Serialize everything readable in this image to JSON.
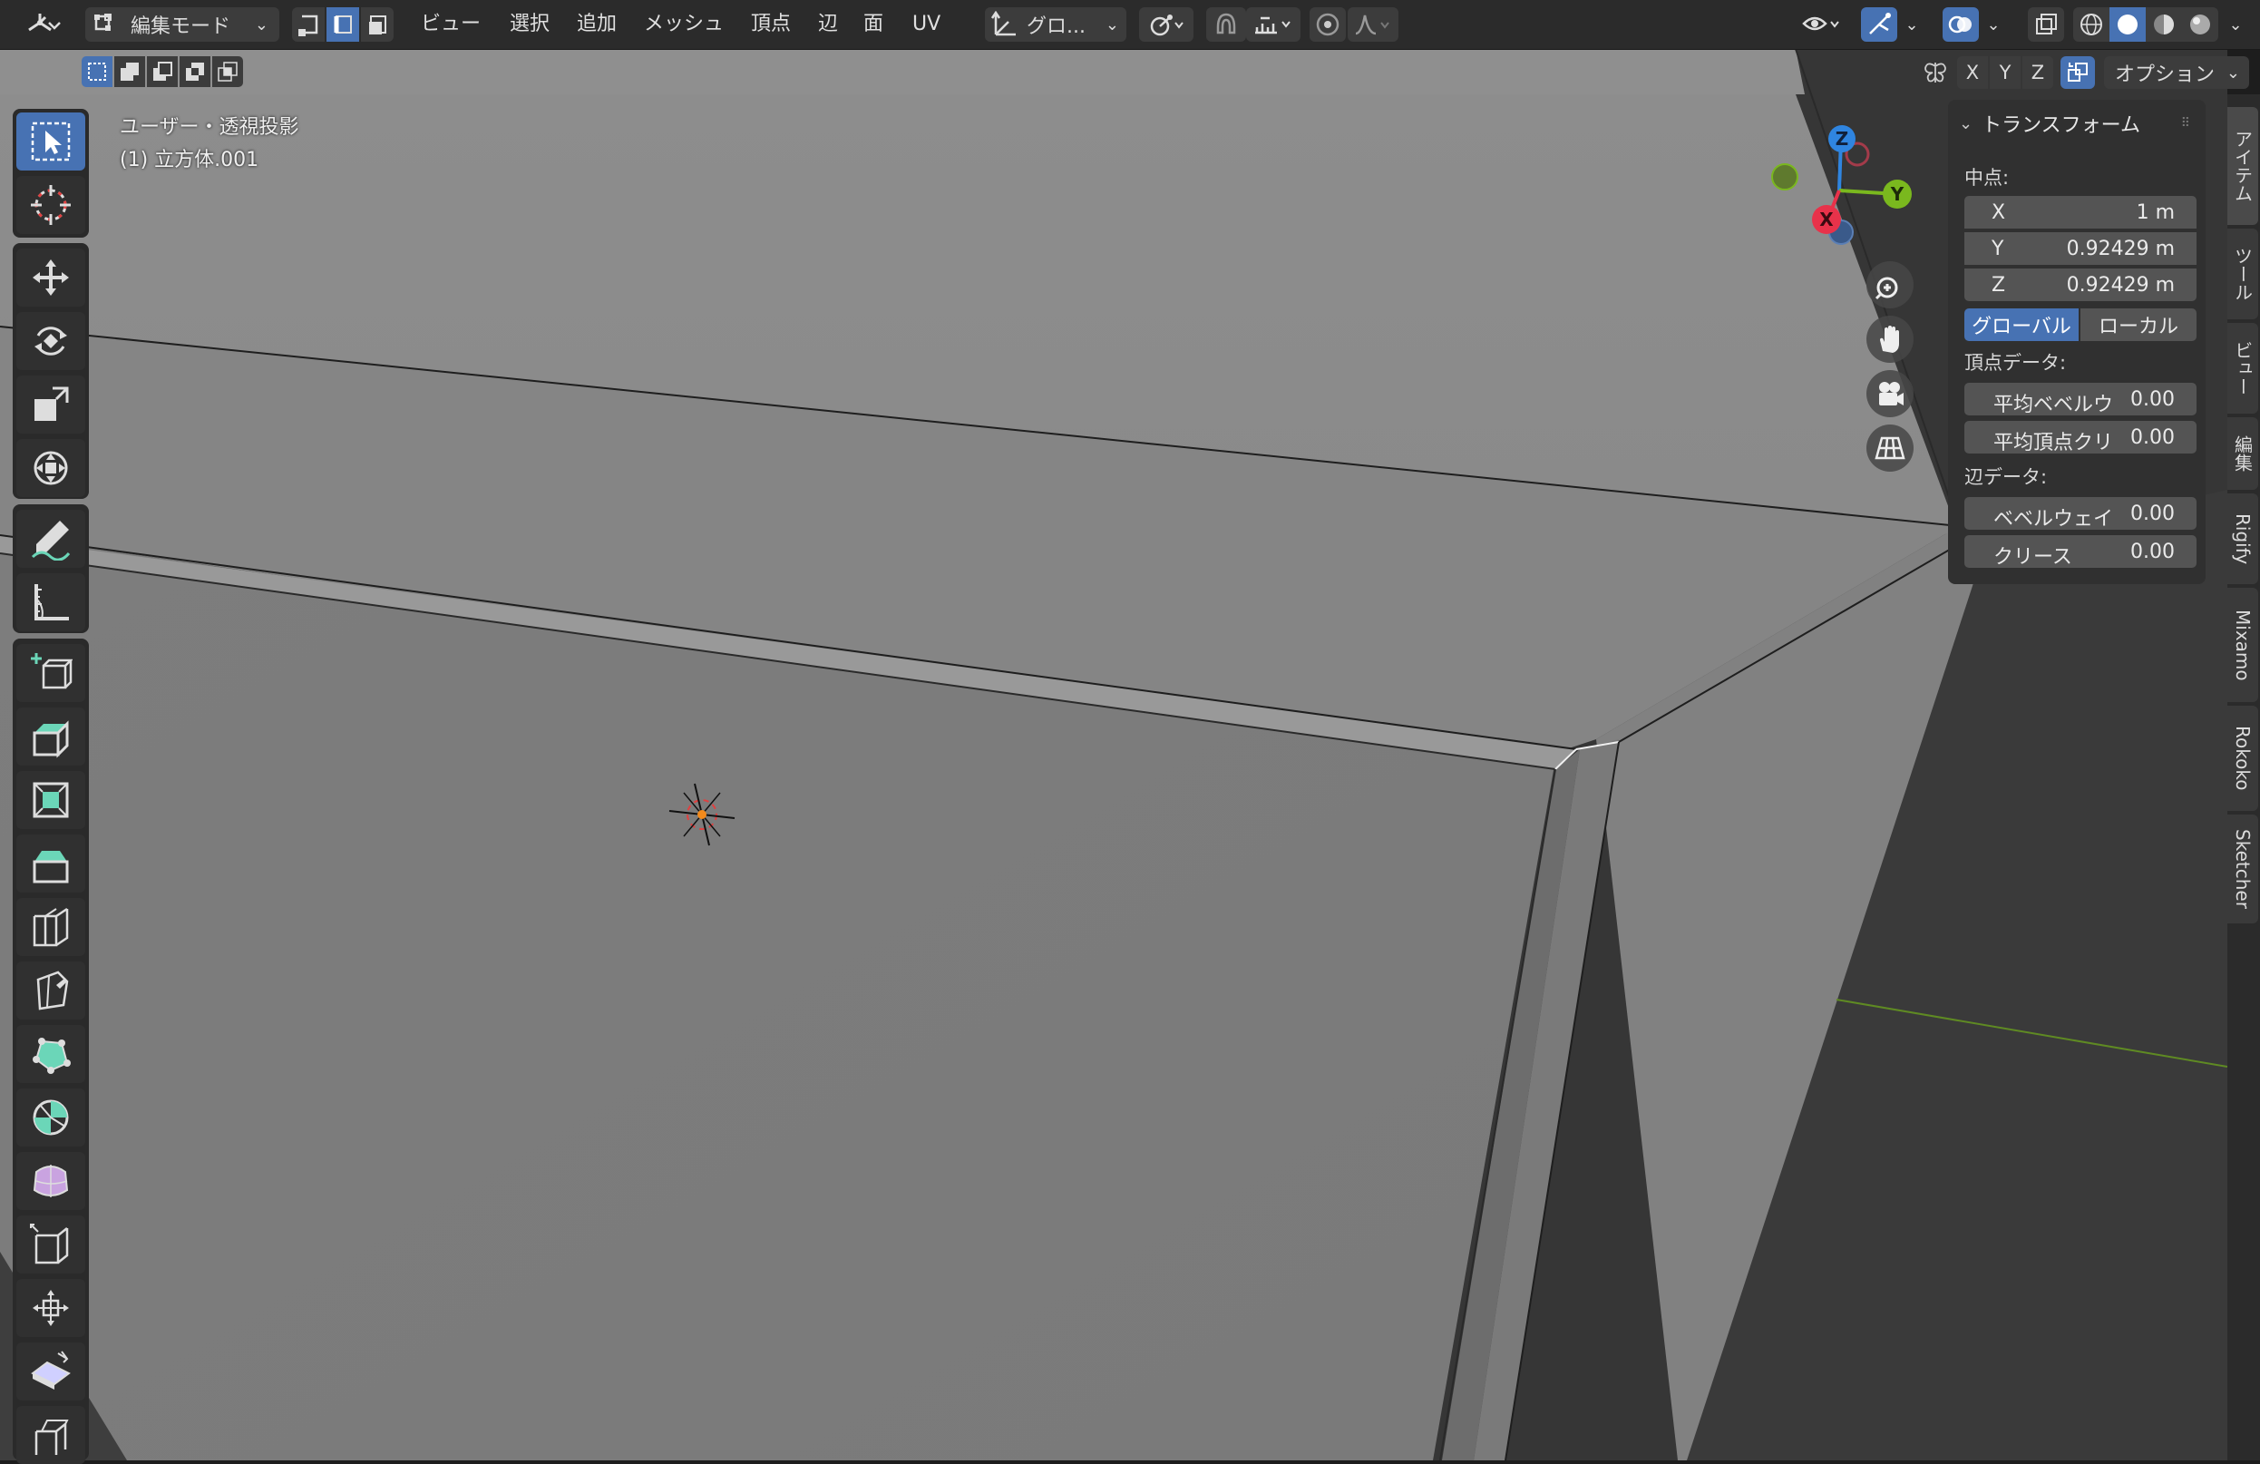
{
  "header": {
    "mode_label": "編集モード",
    "menus": [
      "ビュー",
      "選択",
      "追加",
      "メッシュ",
      "頂点",
      "辺",
      "面",
      "UV"
    ],
    "orientation_label": "グロ...",
    "options_label": "オプション",
    "axis_x": "X",
    "axis_y": "Y",
    "axis_z": "Z"
  },
  "viewport": {
    "view_name": "ユーザー・透視投影",
    "object_name": "(1) 立方体.001",
    "gizmo": {
      "z": "Z",
      "y": "Y",
      "x": "X"
    }
  },
  "toolbar": {
    "tools": [
      "select-box-icon",
      "cursor-icon",
      "move-icon",
      "rotate-icon",
      "scale-icon",
      "transform-icon",
      "annotate-icon",
      "measure-icon",
      "add-cube-icon",
      "extrude-region-icon",
      "inset-faces-icon",
      "bevel-icon",
      "loop-cut-icon",
      "knife-icon",
      "poly-build-icon",
      "spin-icon",
      "smooth-icon",
      "edge-slide-icon",
      "shrink-fatten-icon",
      "shear-icon",
      "rip-region-icon"
    ],
    "active_tool": "select-box-icon"
  },
  "npanel": {
    "section_title": "トランスフォーム",
    "median_label": "中点:",
    "x_label": "X",
    "x_value": "1 m",
    "y_label": "Y",
    "y_value": "0.92429 m",
    "z_label": "Z",
    "z_value": "0.92429 m",
    "global_label": "グローバル",
    "local_label": "ローカル",
    "vertex_data_label": "頂点データ:",
    "mean_bevel_weight_label": "平均ベベルウ",
    "mean_bevel_weight_value": "0.00",
    "mean_vertex_crease_label": "平均頂点クリ",
    "mean_vertex_crease_value": "0.00",
    "edge_data_label": "辺データ:",
    "bevel_weight_label": "ベベルウェイ",
    "bevel_weight_value": "0.00",
    "crease_label": "クリース",
    "crease_value": "0.00"
  },
  "sidebar_tabs": [
    "アイテム",
    "ツール",
    "ビュー",
    "編集",
    "Rigify",
    "Mixamo",
    "Rokoko",
    "Sketcher"
  ],
  "colors": {
    "accent": "#4772b3",
    "axis_x": "#e8324a",
    "axis_y": "#7ab81e",
    "axis_z": "#2f85e0",
    "cursor": "#f28a1c"
  }
}
